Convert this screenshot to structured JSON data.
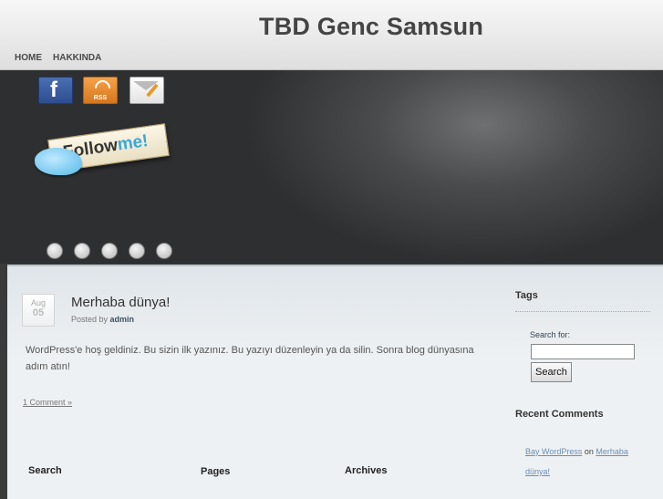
{
  "site": {
    "title": "TBD Genc Samsun"
  },
  "nav": {
    "items": [
      "HOME",
      "HAKKINDA"
    ]
  },
  "banner": {
    "rss_label": "RSS",
    "follow_text_a": "Follow",
    "follow_text_b": "me!"
  },
  "post": {
    "month": "Aug",
    "day": "05",
    "title": "Merhaba dünya!",
    "posted_by_label": "Posted by",
    "author": "admin",
    "body": "WordPress'e hoş geldiniz. Bu sizin ilk yazınız. Bu yazıyı düzenleyin ya da silin. Sonra blog dünyasına adım atın!",
    "comment_link": "1 Comment »"
  },
  "footer": {
    "search": "Search",
    "pages": "Pages",
    "archives": "Archives"
  },
  "sidebar": {
    "tags_heading": "Tags",
    "search_label": "Search for:",
    "search_value": "",
    "search_button": "Search",
    "recent_comments_heading": "Recent Comments",
    "recent_comment": {
      "author": "Bay WordPress",
      "on": "on",
      "post": "Merhaba dünya!"
    }
  }
}
